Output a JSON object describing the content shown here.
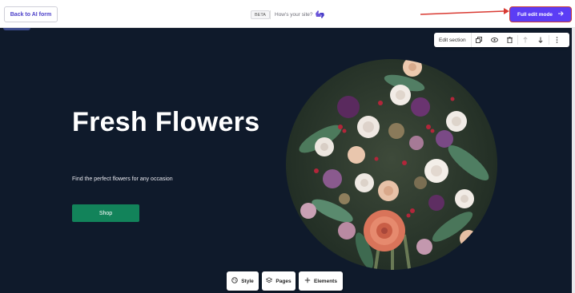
{
  "topbar": {
    "back_label": "Back to AI form",
    "beta_label": "BETA",
    "feedback_text": "How's your site?",
    "feedback_icon": "thumbs-feedback-icon",
    "full_edit_label": "Full edit mode",
    "full_edit_icon": "arrow-right-icon",
    "accent_color": "#5b3df5",
    "annotation_color": "#d93a32"
  },
  "section_toolbar": {
    "edit_label": "Edit section",
    "icons": [
      "duplicate-icon",
      "eye-icon",
      "trash-icon",
      "arrow-up-icon",
      "arrow-down-icon",
      "more-vertical-icon"
    ]
  },
  "hero": {
    "title": "Fresh Flowers",
    "subtitle": "Find the perfect flowers for any occasion",
    "cta_label": "Shop",
    "background_color": "#0f1a2b",
    "cta_color": "#12835a"
  },
  "bottom_toolbar": {
    "style_label": "Style",
    "pages_label": "Pages",
    "elements_label": "Elements"
  }
}
